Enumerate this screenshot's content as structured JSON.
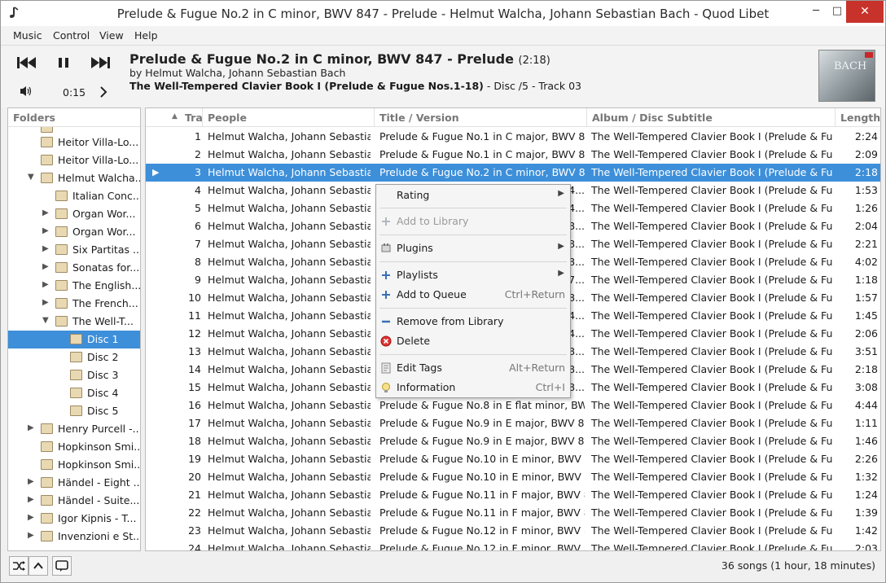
{
  "window": {
    "title": "Prelude & Fugue No.2 in C minor, BWV 847 - Prelude - Helmut Walcha, Johann Sebastian Bach - Quod Libet",
    "controls": {
      "minimize": "─",
      "maximize": "□",
      "close": "✕"
    }
  },
  "menubar": [
    "Music",
    "Control",
    "View",
    "Help"
  ],
  "player": {
    "title": "Prelude & Fugue No.2 in C minor, BWV 847",
    "part": " - Prelude",
    "length": "(2:18)",
    "artist": "by Helmut Walcha, Johann Sebastian Bach",
    "album": "The Well-Tempered Clavier Book I (Prelude & Fugue Nos.1-18)",
    "disc_track": "  - Disc /5 - Track 03",
    "position": "0:15",
    "icons": {
      "prev": "previous-icon",
      "pause": "pause-icon",
      "next": "next-icon",
      "volume": "volume-icon",
      "seek": "chevron-right-icon"
    },
    "cover_text": "BACH"
  },
  "folders": {
    "header": "Folders",
    "items": [
      {
        "label": "Heitor Villa-Lo...",
        "level": 0,
        "expander": ""
      },
      {
        "label": "Heitor Villa-Lo...",
        "level": 0,
        "expander": ""
      },
      {
        "label": "Helmut Walcha...",
        "level": 0,
        "expander": "▼"
      },
      {
        "label": "Italian Conc...",
        "level": 1,
        "expander": ""
      },
      {
        "label": "Organ Wor...",
        "level": 1,
        "expander": "▶"
      },
      {
        "label": "Organ Wor...",
        "level": 1,
        "expander": "▶"
      },
      {
        "label": "Six Partitas ...",
        "level": 1,
        "expander": "▶"
      },
      {
        "label": "Sonatas for...",
        "level": 1,
        "expander": "▶"
      },
      {
        "label": "The English...",
        "level": 1,
        "expander": "▶"
      },
      {
        "label": "The French...",
        "level": 1,
        "expander": "▶"
      },
      {
        "label": "The Well-T...",
        "level": 1,
        "expander": "▼"
      },
      {
        "label": "Disc 1",
        "level": 2,
        "expander": "",
        "selected": true
      },
      {
        "label": "Disc 2",
        "level": 2,
        "expander": ""
      },
      {
        "label": "Disc 3",
        "level": 2,
        "expander": ""
      },
      {
        "label": "Disc 4",
        "level": 2,
        "expander": ""
      },
      {
        "label": "Disc 5",
        "level": 2,
        "expander": ""
      },
      {
        "label": "Henry Purcell -...",
        "level": 0,
        "expander": "▶"
      },
      {
        "label": "Hopkinson Smi...",
        "level": 0,
        "expander": ""
      },
      {
        "label": "Hopkinson Smi...",
        "level": 0,
        "expander": ""
      },
      {
        "label": "Händel - Eight ...",
        "level": 0,
        "expander": "▶"
      },
      {
        "label": "Händel - Suite...",
        "level": 0,
        "expander": "▶"
      },
      {
        "label": "Igor Kipnis - T...",
        "level": 0,
        "expander": "▶"
      },
      {
        "label": "Invenzioni e St...",
        "level": 0,
        "expander": "▶"
      }
    ]
  },
  "songlist": {
    "columns": {
      "track": "Tra",
      "people": "People",
      "title": "Title / Version",
      "album": "Album / Disc Subtitle",
      "length": "Length"
    },
    "sort_icon": "sort-asc-icon",
    "rows": [
      {
        "n": "1",
        "people": "Helmut Walcha, Johann Sebastia...",
        "title": "Prelude & Fugue No.1 in C major, BWV 8...",
        "album": "The Well-Tempered Clavier Book I (Prelude & Fu...",
        "len": "2:24"
      },
      {
        "n": "2",
        "people": "Helmut Walcha, Johann Sebastia...",
        "title": "Prelude & Fugue No.1 in C major, BWV 8...",
        "album": "The Well-Tempered Clavier Book I (Prelude & Fu...",
        "len": "2:09"
      },
      {
        "n": "3",
        "people": "Helmut Walcha, Johann Sebastia...",
        "title": "Prelude & Fugue No.2 in C minor, BWV 84...",
        "album": "The Well-Tempered Clavier Book I (Prelude & Fu...",
        "len": "2:18",
        "selected": true
      },
      {
        "n": "4",
        "people": "Helmut Walcha, Johann Sebastia...",
        "title": "",
        "album": "The Well-Tempered Clavier Book I (Prelude & Fu...",
        "len": "1:53"
      },
      {
        "n": "5",
        "people": "Helmut Walcha, Johann Sebastia...",
        "title": "",
        "album": "The Well-Tempered Clavier Book I (Prelude & Fu...",
        "len": "1:26"
      },
      {
        "n": "6",
        "people": "Helmut Walcha, Johann Sebastia...",
        "title": "",
        "album": "The Well-Tempered Clavier Book I (Prelude & Fu...",
        "len": "2:04"
      },
      {
        "n": "7",
        "people": "Helmut Walcha, Johann Sebastia...",
        "title": "",
        "album": "The Well-Tempered Clavier Book I (Prelude & Fu...",
        "len": "2:21"
      },
      {
        "n": "8",
        "people": "Helmut Walcha, Johann Sebastia...",
        "title": "",
        "album": "The Well-Tempered Clavier Book I (Prelude & Fu...",
        "len": "4:02"
      },
      {
        "n": "9",
        "people": "Helmut Walcha, Johann Sebastia...",
        "title": "",
        "album": "The Well-Tempered Clavier Book I (Prelude & Fu...",
        "len": "1:18"
      },
      {
        "n": "10",
        "people": "Helmut Walcha, Johann Sebastia...",
        "title": "",
        "album": "The Well-Tempered Clavier Book I (Prelude & Fu...",
        "len": "1:57"
      },
      {
        "n": "11",
        "people": "Helmut Walcha, Johann Sebastia...",
        "title": "",
        "album": "The Well-Tempered Clavier Book I (Prelude & Fu...",
        "len": "1:45"
      },
      {
        "n": "12",
        "people": "Helmut Walcha, Johann Sebastia...",
        "title": "",
        "album": "The Well-Tempered Clavier Book I (Prelude & Fu...",
        "len": "2:06"
      },
      {
        "n": "13",
        "people": "Helmut Walcha, Johann Sebastia...",
        "title": "",
        "album": "The Well-Tempered Clavier Book I (Prelude & Fu...",
        "len": "3:51"
      },
      {
        "n": "14",
        "people": "Helmut Walcha, Johann Sebastia...",
        "title": "",
        "album": "The Well-Tempered Clavier Book I (Prelude & Fu...",
        "len": "2:18"
      },
      {
        "n": "15",
        "people": "Helmut Walcha, Johann Sebastia...",
        "title": "",
        "album": "The Well-Tempered Clavier Book I (Prelude & Fu...",
        "len": "3:08"
      },
      {
        "n": "16",
        "people": "Helmut Walcha, Johann Sebastia...",
        "title": "Prelude & Fugue No.8 in E flat minor, BW...",
        "album": "The Well-Tempered Clavier Book I (Prelude & Fu...",
        "len": "4:44"
      },
      {
        "n": "17",
        "people": "Helmut Walcha, Johann Sebastia...",
        "title": "Prelude & Fugue No.9 in E major, BWV 85...",
        "album": "The Well-Tempered Clavier Book I (Prelude & Fu...",
        "len": "1:11"
      },
      {
        "n": "18",
        "people": "Helmut Walcha, Johann Sebastia...",
        "title": "Prelude & Fugue No.9 in E major, BWV 85...",
        "album": "The Well-Tempered Clavier Book I (Prelude & Fu...",
        "len": "1:46"
      },
      {
        "n": "19",
        "people": "Helmut Walcha, Johann Sebastia...",
        "title": "Prelude & Fugue No.10 in E minor, BWV 8...",
        "album": "The Well-Tempered Clavier Book I (Prelude & Fu...",
        "len": "2:26"
      },
      {
        "n": "20",
        "people": "Helmut Walcha, Johann Sebastia...",
        "title": "Prelude & Fugue No.10 in E minor, BWV 8...",
        "album": "The Well-Tempered Clavier Book I (Prelude & Fu...",
        "len": "1:32"
      },
      {
        "n": "21",
        "people": "Helmut Walcha, Johann Sebastia...",
        "title": "Prelude & Fugue No.11 in F major, BWV 8...",
        "album": "The Well-Tempered Clavier Book I (Prelude & Fu...",
        "len": "1:24"
      },
      {
        "n": "22",
        "people": "Helmut Walcha, Johann Sebastia...",
        "title": "Prelude & Fugue No.11 in F major, BWV 8...",
        "album": "The Well-Tempered Clavier Book I (Prelude & Fu...",
        "len": "1:39"
      },
      {
        "n": "23",
        "people": "Helmut Walcha, Johann Sebastia...",
        "title": "Prelude & Fugue No.12 in F minor, BWV 8...",
        "album": "The Well-Tempered Clavier Book I (Prelude & Fu...",
        "len": "1:42"
      },
      {
        "n": "24",
        "people": "Helmut Walcha, Johann Sebastia...",
        "title": "Prelude & Fugue No.12 in F minor, BWV 8...",
        "album": "The Well-Tempered Clavier Book I (Prelude & Fu...",
        "len": "2:03"
      }
    ],
    "hidden_title_fragments": [
      "4...",
      "4...",
      "8...",
      "8...",
      "8...",
      "7...",
      "8...",
      "4...",
      "4...",
      "8...",
      "8...",
      "8..."
    ]
  },
  "context_menu": {
    "items": [
      {
        "label": "Rating",
        "submenu": true,
        "icon": ""
      },
      {
        "label": "Add to Library",
        "disabled": true,
        "icon": "add-icon"
      },
      {
        "label": "Plugins",
        "submenu": true,
        "icon": "plugins-icon"
      },
      {
        "label": "Playlists",
        "submenu": true,
        "icon": "add-icon"
      },
      {
        "label": "Add to Queue",
        "accel": "Ctrl+Return",
        "icon": "add-icon"
      },
      {
        "label": "Remove from Library",
        "icon": "remove-icon"
      },
      {
        "label": "Delete",
        "icon": "delete-icon"
      },
      {
        "label": "Edit Tags",
        "accel": "Alt+Return",
        "icon": "edit-tags-icon"
      },
      {
        "label": "Information",
        "accel": "Ctrl+I",
        "icon": "information-icon"
      }
    ]
  },
  "bottombar": {
    "status": "36 songs (1 hour, 18 minutes)",
    "buttons": [
      "shuffle-icon",
      "repeat-up-icon",
      "queue-icon"
    ]
  },
  "colors": {
    "selection": "#3d8fd9",
    "close": "#c7322b"
  }
}
